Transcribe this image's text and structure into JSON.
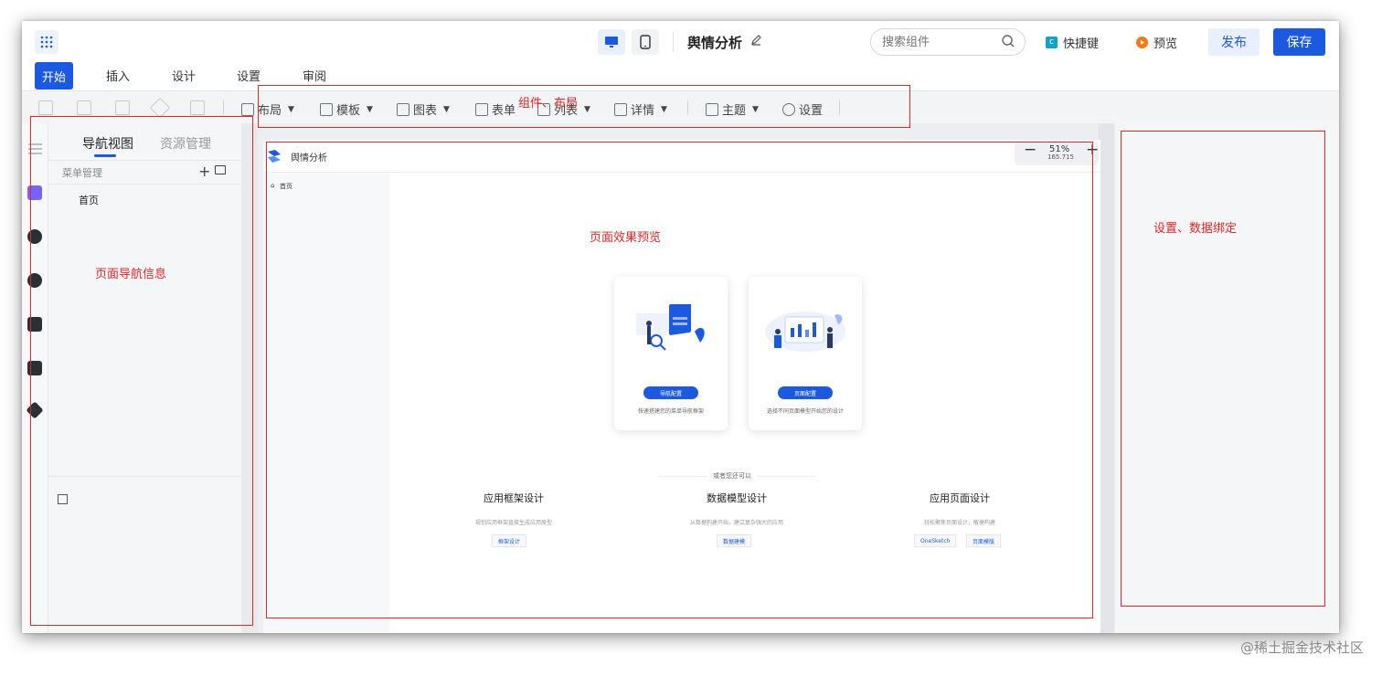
{
  "header": {
    "title": "舆情分析",
    "search_placeholder": "搜索组件",
    "shortcut_label": "快捷键",
    "preview_label": "预览",
    "publish_label": "发布",
    "save_label": "保存"
  },
  "tabs": [
    "开始",
    "插入",
    "设计",
    "设置",
    "审阅"
  ],
  "toolbar": {
    "layout": "布局",
    "template": "模板",
    "chart": "图表",
    "form": "表单",
    "list": "列表",
    "detail": "详情",
    "theme": "主题",
    "settings": "设置"
  },
  "left_panel": {
    "tab_nav": "导航视图",
    "tab_resources": "资源管理",
    "menu_header": "菜单管理",
    "items": [
      "首页"
    ]
  },
  "preview": {
    "app_name": "舆情分析",
    "zoom": "51%",
    "zoom_sub": "165.715",
    "breadcrumb": "首页",
    "card1": {
      "button": "导航配置",
      "desc": "快速搭建您的菜单导航框架"
    },
    "card2": {
      "button": "页面配置",
      "desc": "选择不同页面模型开始您的设计"
    },
    "divider_text": "或者您还可以",
    "sections": [
      {
        "title": "应用框架设计",
        "desc": "规划应用框架直接生成应用原型",
        "tags": [
          "框架设计"
        ]
      },
      {
        "title": "数据模型设计",
        "desc": "从数据构建开始，建立复杂强大的应用",
        "tags": [
          "数据建模"
        ]
      },
      {
        "title": "应用页面设计",
        "desc": "轻松聚焦页面设计，敏捷构建",
        "tags": [
          "OneSketch",
          "页面模版"
        ]
      }
    ]
  },
  "annotations": {
    "toolbar": "组件、布局",
    "left": "页面导航信息",
    "preview": "页面效果预览",
    "right": "设置、数据绑定"
  },
  "watermark": "@稀土掘金技术社区",
  "colors": {
    "accent": "#1b5ae0",
    "annotation": "#e32626"
  }
}
